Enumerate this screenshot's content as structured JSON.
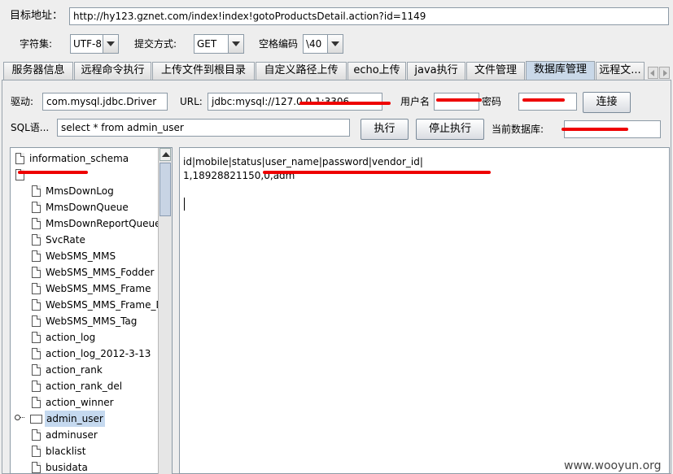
{
  "target": {
    "label": "目标地址：",
    "url": "http://hy123.gznet.com/index!index!gotoProductsDetail.action?id=1149"
  },
  "options": {
    "charset_label": "字符集:",
    "charset_value": "UTF-8",
    "method_label": "提交方式:",
    "method_value": "GET",
    "space_label": "空格编码",
    "space_value": "\\40"
  },
  "tabs": [
    "服务器信息",
    "远程命令执行",
    "上传文件到根目录",
    "自定义路径上传",
    "echo上传",
    "java执行",
    "文件管理",
    "数据库管理",
    "远程文..."
  ],
  "active_tab": "数据库管理",
  "db": {
    "driver_label": "驱动:",
    "driver_value": "com.mysql.jdbc.Driver",
    "url_label": "URL:",
    "url_value": "jdbc:mysql://127.0.0.1:3306",
    "user_label": "用户名",
    "password_label": "密码",
    "connect_button": "连接",
    "sql_label": "SQL语...",
    "sql_value": "select * from admin_user",
    "execute_button": "执行",
    "stop_button": "停止执行",
    "current_db_label": "当前数据库:"
  },
  "tree": {
    "items": [
      {
        "label": "information_schema",
        "kind": "db"
      },
      {
        "label": "",
        "kind": "db-open"
      },
      {
        "label": "MmsDownLog",
        "kind": "table"
      },
      {
        "label": "MmsDownQueue",
        "kind": "table"
      },
      {
        "label": "MmsDownReportQueue",
        "kind": "table"
      },
      {
        "label": "SvcRate",
        "kind": "table"
      },
      {
        "label": "WebSMS_MMS",
        "kind": "table"
      },
      {
        "label": "WebSMS_MMS_Fodder",
        "kind": "table"
      },
      {
        "label": "WebSMS_MMS_Frame",
        "kind": "table"
      },
      {
        "label": "WebSMS_MMS_Frame_D",
        "kind": "table"
      },
      {
        "label": "WebSMS_MMS_Tag",
        "kind": "table"
      },
      {
        "label": "action_log",
        "kind": "table"
      },
      {
        "label": "action_log_2012-3-13",
        "kind": "table"
      },
      {
        "label": "action_rank",
        "kind": "table"
      },
      {
        "label": "action_rank_del",
        "kind": "table"
      },
      {
        "label": "action_winner",
        "kind": "table"
      },
      {
        "label": "admin_user",
        "kind": "selected"
      },
      {
        "label": "adminuser",
        "kind": "table"
      },
      {
        "label": "blacklist",
        "kind": "table"
      },
      {
        "label": "busidata",
        "kind": "table"
      }
    ]
  },
  "result": {
    "header": "id|mobile|status|user_name|password|vendor_id|",
    "row1": "1,18928821150,0,adm"
  },
  "watermark": "www.wooyun.org",
  "colors": {
    "selection": "#c5d9ef",
    "redaction": "#ee0000",
    "tab_active": "#c9d8e8"
  }
}
